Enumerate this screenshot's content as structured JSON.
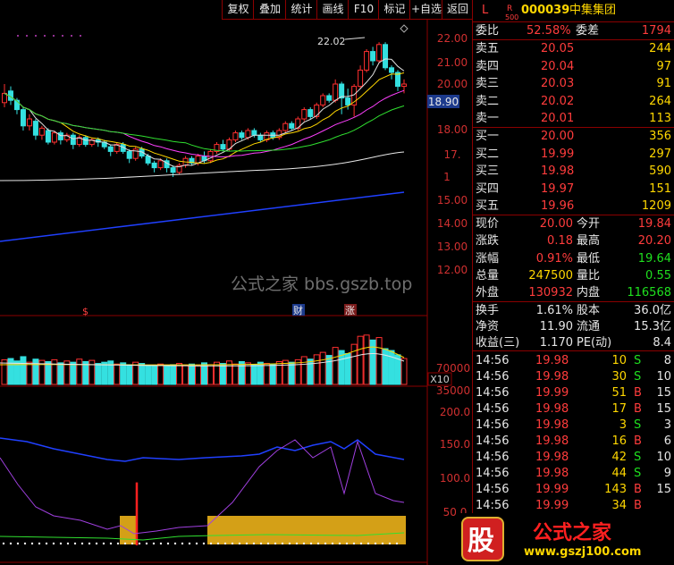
{
  "toolbar": {
    "buttons": [
      "复权",
      "叠加",
      "统计",
      "画线",
      "F10",
      "标记",
      "+自选",
      "返回"
    ]
  },
  "price_chart": {
    "high_label": "22.02",
    "current_price_tag": "18.90",
    "y_ticks": [
      "22.00",
      "21.00",
      "20.00",
      "18.00",
      "17.",
      "1",
      "15.00",
      "14.00",
      "13.00",
      "12.00"
    ],
    "markers": {
      "s": "$",
      "cai": "财",
      "zhang": "涨"
    },
    "watermark": "公式之家 bbs.gszb.top"
  },
  "volume_chart": {
    "y_ticks": [
      "70000",
      "35000"
    ],
    "unit": "X10"
  },
  "indicator_chart": {
    "y_ticks": [
      "200.0",
      "150.0",
      "100.0",
      "50.0"
    ]
  },
  "quote_panel": {
    "header": {
      "l_label": "L",
      "r_label": "R",
      "r_sub": "500",
      "code": "000039",
      "name": "中集集团"
    },
    "weibi": {
      "label": "委比",
      "value": "52.58%",
      "diff_label": "委差",
      "diff_value": "1794"
    },
    "asks": [
      {
        "label": "卖五",
        "price": "20.05",
        "vol": "244"
      },
      {
        "label": "卖四",
        "price": "20.04",
        "vol": "97"
      },
      {
        "label": "卖三",
        "price": "20.03",
        "vol": "91"
      },
      {
        "label": "卖二",
        "price": "20.02",
        "vol": "264"
      },
      {
        "label": "卖一",
        "price": "20.01",
        "vol": "113"
      }
    ],
    "bids": [
      {
        "label": "买一",
        "price": "20.00",
        "vol": "356"
      },
      {
        "label": "买二",
        "price": "19.99",
        "vol": "297"
      },
      {
        "label": "买三",
        "price": "19.98",
        "vol": "590"
      },
      {
        "label": "买四",
        "price": "19.97",
        "vol": "151"
      },
      {
        "label": "买五",
        "price": "19.96",
        "vol": "1209"
      }
    ],
    "stats": [
      {
        "l1": "现价",
        "v1": "20.00",
        "l2": "今开",
        "v2": "19.84",
        "c1": "red",
        "c2": "red"
      },
      {
        "l1": "涨跌",
        "v1": "0.18",
        "l2": "最高",
        "v2": "20.20",
        "c1": "red",
        "c2": "red"
      },
      {
        "l1": "涨幅",
        "v1": "0.91%",
        "l2": "最低",
        "v2": "19.64",
        "c1": "red",
        "c2": "green"
      },
      {
        "l1": "总量",
        "v1": "247500",
        "l2": "量比",
        "v2": "0.55",
        "c1": "yellow",
        "c2": "green"
      },
      {
        "l1": "外盘",
        "v1": "130932",
        "l2": "内盘",
        "v2": "116568",
        "c1": "red",
        "c2": "green"
      }
    ],
    "finance": [
      {
        "l1": "换手",
        "v1": "1.61%",
        "l2": "股本",
        "v2": "36.0亿"
      },
      {
        "l1": "净资",
        "v1": "11.90",
        "l2": "流通",
        "v2": "15.3亿"
      },
      {
        "l1": "收益(三)",
        "v1": "1.170",
        "l2": "PE(动)",
        "v2": "8.4"
      }
    ],
    "ticks": [
      {
        "time": "14:56",
        "price": "19.98",
        "vol": "10",
        "bs": "S",
        "n": "8"
      },
      {
        "time": "14:56",
        "price": "19.98",
        "vol": "30",
        "bs": "S",
        "n": "10"
      },
      {
        "time": "14:56",
        "price": "19.99",
        "vol": "51",
        "bs": "B",
        "n": "15"
      },
      {
        "time": "14:56",
        "price": "19.98",
        "vol": "17",
        "bs": "B",
        "n": "15"
      },
      {
        "time": "14:56",
        "price": "19.98",
        "vol": "3",
        "bs": "S",
        "n": "3"
      },
      {
        "time": "14:56",
        "price": "19.98",
        "vol": "16",
        "bs": "B",
        "n": "6"
      },
      {
        "time": "14:56",
        "price": "19.98",
        "vol": "42",
        "bs": "S",
        "n": "10"
      },
      {
        "time": "14:56",
        "price": "19.98",
        "vol": "44",
        "bs": "S",
        "n": "9"
      },
      {
        "time": "14:56",
        "price": "19.99",
        "vol": "143",
        "bs": "B",
        "n": "15"
      },
      {
        "time": "14:56",
        "price": "19.99",
        "vol": "34",
        "bs": "B",
        "n": ""
      }
    ]
  },
  "logo": {
    "char": "股",
    "text": "公式之家",
    "url": "www.gszj100.com"
  }
}
